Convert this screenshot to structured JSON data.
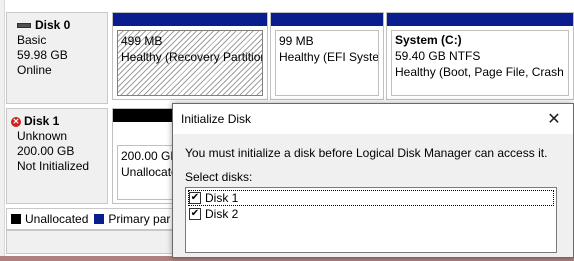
{
  "disks": [
    {
      "name": "Disk 0",
      "type": "Basic",
      "size": "59.98 GB",
      "status": "Online",
      "icon": "disk-online-icon",
      "partitions": [
        {
          "size": "499 MB",
          "status": "Healthy (Recovery Partition",
          "style": "hatched"
        },
        {
          "size": "99 MB",
          "status": "Healthy (EFI System",
          "style": "plain"
        },
        {
          "name": "System  (C:)",
          "size": "59.40 GB NTFS",
          "status": "Healthy (Boot, Page File, Crash Du",
          "style": "plain"
        }
      ]
    },
    {
      "name": "Disk 1",
      "type": "Unknown",
      "size": "200.00 GB",
      "status": "Not Initialized",
      "icon": "disk-error-icon",
      "partitions": [
        {
          "size": "200.00 GB",
          "status": "Unallocate",
          "style": "unallocated"
        }
      ]
    }
  ],
  "legend": [
    {
      "label": "Unallocated",
      "color": "#000000"
    },
    {
      "label": "Primary par",
      "color": "#0a1d8f"
    }
  ],
  "dialog": {
    "title": "Initialize Disk",
    "close_icon": "close-icon",
    "message": "You must initialize a disk before Logical Disk Manager can access it.",
    "select_label": "Select disks:",
    "disks": [
      {
        "label": "Disk 1",
        "checked": true
      },
      {
        "label": "Disk 2",
        "checked": true
      }
    ]
  }
}
